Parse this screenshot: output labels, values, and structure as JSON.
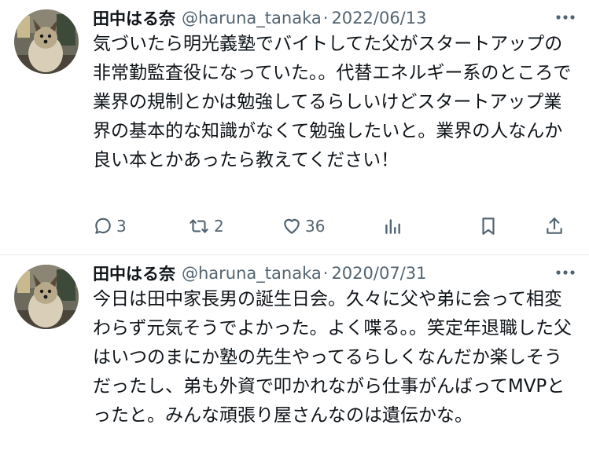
{
  "tweets": [
    {
      "author_name": "田中はる奈",
      "handle": "@haruna_tanaka",
      "separator": "·",
      "date": "2022/06/13",
      "text": "気づいたら明光義塾でバイトしてた父がスタートアップの非常勤監査役になっていた。。代替エネルギー系のところで業界の規制とかは勉強してるらしいけどスタートアップ業界の基本的な知識がなくて勉強したいと。業界の人なんか良い本とかあったら教えてください！",
      "replies": "3",
      "retweets": "2",
      "likes": "36"
    },
    {
      "author_name": "田中はる奈",
      "handle": "@haruna_tanaka",
      "separator": "·",
      "date": "2020/07/31",
      "text": "今日は田中家長男の誕生日会。久々に父や弟に会って相変わらず元気そうでよかった。よく喋る。。笑定年退職した父はいつのまにか塾の先生やってるらしくなんだか楽しそうだったし、弟も外資で叩かれながら仕事がんばってMVPとったと。みんな頑張り屋さんなのは遺伝かな。"
    }
  ],
  "icons": {
    "reply": "reply-icon",
    "retweet": "retweet-icon",
    "like": "heart-icon",
    "views": "views-icon",
    "bookmark": "bookmark-icon",
    "share": "share-icon",
    "more": "more-icon"
  },
  "colors": {
    "text": "#0f1419",
    "secondary": "#536471",
    "divider": "#e6e9ec"
  }
}
